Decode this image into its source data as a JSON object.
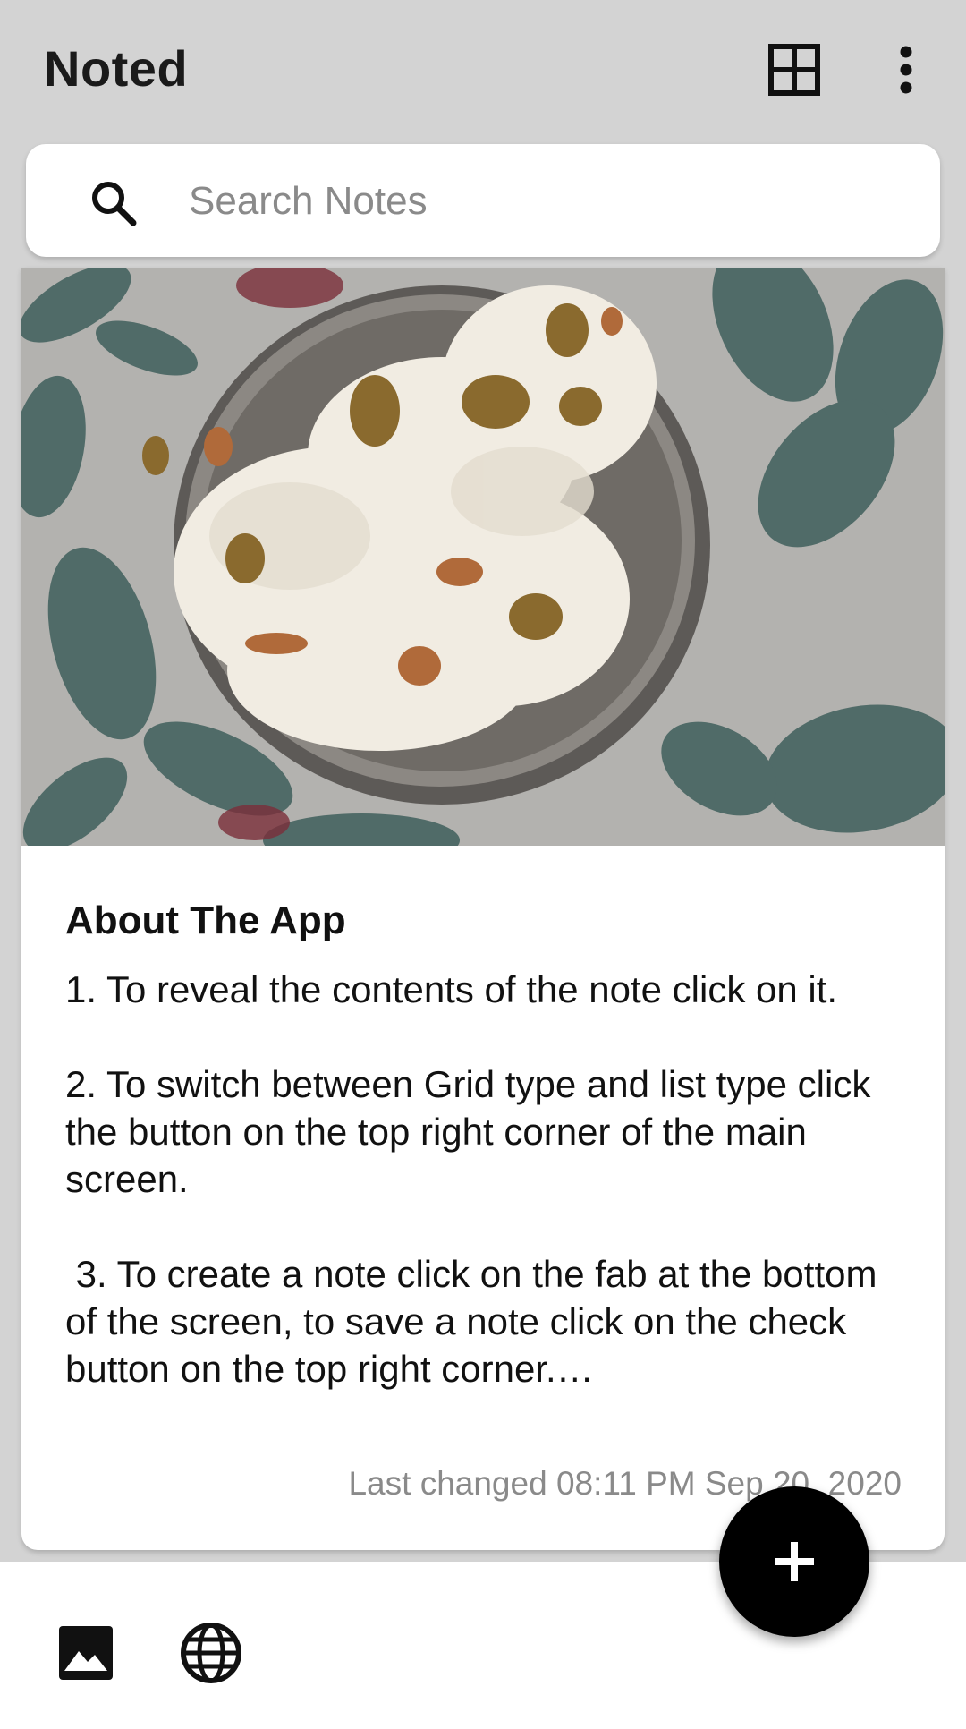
{
  "app": {
    "title": "Noted"
  },
  "toolbar": {
    "layout_toggle_icon": "grid-view-icon",
    "overflow_icon": "more-vert-icon"
  },
  "search": {
    "placeholder": "Search Notes",
    "value": "",
    "icon": "search-icon"
  },
  "notes": [
    {
      "image": "photo of a steel bowl of creamy dessert with raisins on floral cloth",
      "title": "About The App",
      "body": "1. To reveal the contents of the note click on it.\n\n2. To switch between Grid type and list type click the button on the top right corner of the main screen.\n\n 3. To create a note click on the fab at the bottom of the screen, to save a note click on the check button on the top right corner.…",
      "last_changed": "Last changed 08:11 PM Sep 20, 2020"
    }
  ],
  "bottom_bar": {
    "image_icon": "image-icon",
    "web_icon": "globe-icon"
  },
  "fab": {
    "icon": "add-icon"
  },
  "colors": {
    "background": "#d3d3d3",
    "surface": "#ffffff",
    "fab": "#000000",
    "secondary_text": "#8a8a8a"
  }
}
